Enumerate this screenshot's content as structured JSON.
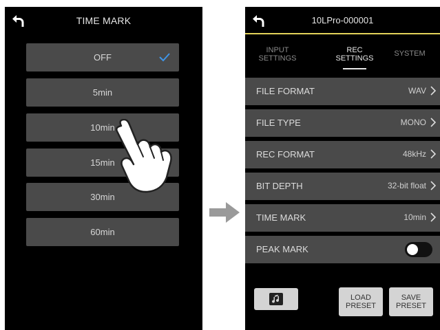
{
  "left": {
    "title": "TIME MARK",
    "options": [
      "OFF",
      "5min",
      "10min",
      "15min",
      "30min",
      "60min"
    ],
    "selected": "OFF",
    "icons": {
      "back": "back-arrow-icon",
      "check": "check-icon",
      "hand": "pointing-hand-icon"
    }
  },
  "arrow": "right-arrow-icon",
  "right": {
    "title": "10LPro-000001",
    "accent_color": "#e4d35a",
    "tabs": [
      {
        "line1": "INPUT",
        "line2": "SETTINGS",
        "active": false
      },
      {
        "line1": "REC",
        "line2": "SETTINGS",
        "active": true
      },
      {
        "line1": "SYSTEM",
        "line2": "",
        "active": false
      }
    ],
    "rows": [
      {
        "label": "FILE FORMAT",
        "value": "WAV"
      },
      {
        "label": "FILE TYPE",
        "value": "MONO"
      },
      {
        "label": "REC FORMAT",
        "value": "48kHz"
      },
      {
        "label": "BIT DEPTH",
        "value": "32-bit float"
      },
      {
        "label": "TIME MARK",
        "value": "10min"
      }
    ],
    "peak_mark": {
      "label": "PEAK MARK",
      "enabled": false
    },
    "buttons": {
      "music_icon": "music-note-icon",
      "load_line1": "LOAD",
      "load_line2": "PRESET",
      "save_line1": "SAVE",
      "save_line2": "PRESET"
    }
  }
}
